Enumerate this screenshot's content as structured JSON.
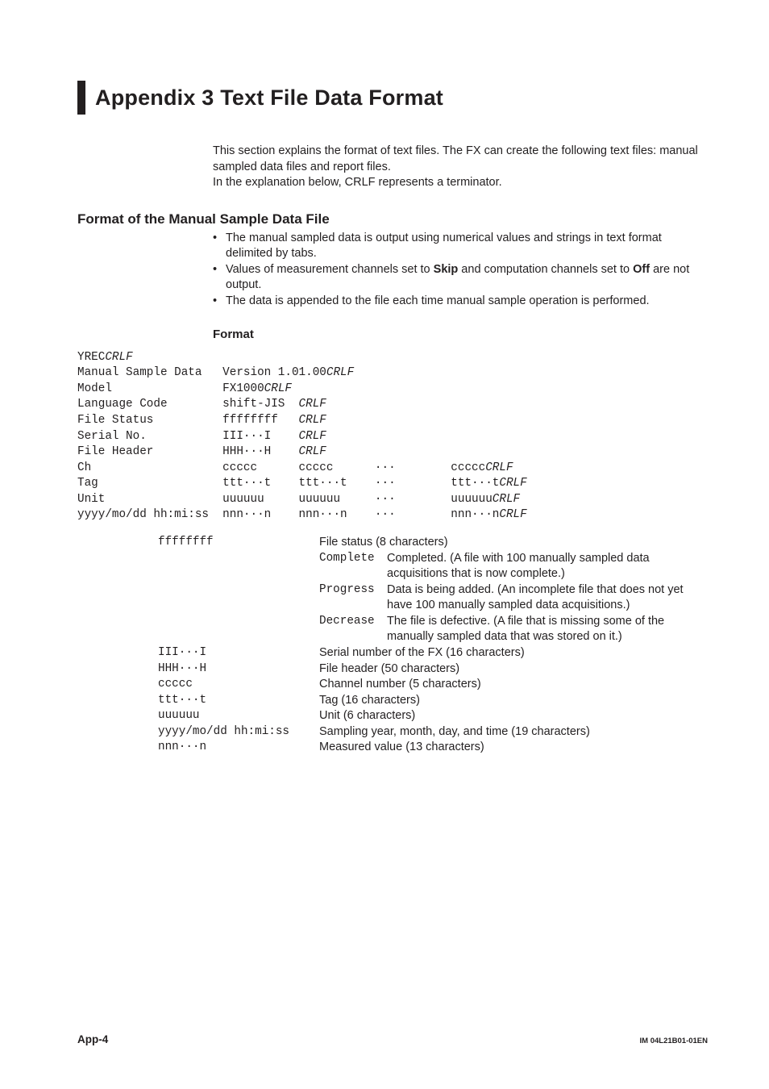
{
  "title": "Appendix 3   Text File Data Format",
  "intro": {
    "p1": "This section explains the format of text files. The FX can create the following text files: manual sampled data files and report files.",
    "p2": "In the explanation below, CRLF represents a terminator."
  },
  "section1": {
    "heading": "Format of the Manual Sample Data File",
    "b1": "The manual sampled data is output using numerical values and strings in text format delimited by tabs.",
    "b2a": "Values of measurement channels set to ",
    "b2b": "Skip",
    "b2c": " and computation channels set to ",
    "b2d": "Off",
    "b2e": " are not output.",
    "b3": "The data is appended to the file each time manual sample operation is performed."
  },
  "formatHeading": "Format",
  "formatBlock": "YRECCRLF\nManual Sample Data   Version 1.01.00CRLF\nModel                FX1000CRLF\nLanguage Code        shift-JIS  CRLF\nFile Status          ffffffff   CRLF\nSerial No.           III···I    CRLF\nFile Header          HHH···H    CRLF\nCh                   ccccc      ccccc      ···        cccccCRLF\nTag                  ttt···t    ttt···t    ···        ttt···tCRLF\nUnit                 uuuuuu     uuuuuu     ···        uuuuuuCRLF\nyyyy/mo/dd hh:mi:ss  nnn···n    nnn···n    ···        nnn···nCRLF",
  "defs": {
    "fileStatusKey": "ffffffff",
    "fileStatusDesc": "File status (8 characters)",
    "completeKey": "Complete",
    "completeDesc": "Completed. (A file with 100 manually sampled data acquisitions that is now complete.)",
    "progressKey": "Progress",
    "progressDesc": "Data is being added. (An incomplete file that does not yet have 100 manually sampled data acquisitions.)",
    "decreaseKey": "Decrease",
    "decreaseDesc": "The file is defective. (A file that is missing some of the manually sampled data that was stored on it.)",
    "serialKey": "III···I",
    "serialDesc": "Serial number of the FX (16 characters)",
    "headerKey": "HHH···H",
    "headerDesc": "File header (50 characters)",
    "chKey": "ccccc",
    "chDesc": "Channel number (5 characters)",
    "tagKey": "ttt···t",
    "tagDesc": "Tag (16 characters)",
    "unitKey": "uuuuuu",
    "unitDesc": "Unit (6 characters)",
    "tsKey": "yyyy/mo/dd hh:mi:ss",
    "tsDesc": "Sampling year, month, day, and time (19 characters)",
    "valKey": "nnn···n",
    "valDesc": "Measured value (13 characters)"
  },
  "footer": {
    "page": "App-4",
    "docid": "IM 04L21B01-01EN"
  },
  "bulletDot": "•"
}
